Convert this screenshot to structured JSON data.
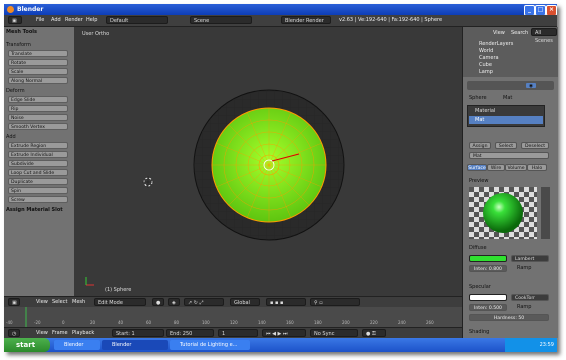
{
  "window": {
    "title": "Blender"
  },
  "topbar": {
    "file": "File",
    "add": "Add",
    "render": "Render",
    "help": "Help",
    "layout": "Default",
    "scene": "Scene",
    "engine": "Blender Render",
    "stats": "v2.63 | Ve:192-640 | Fa:192-640 | Sphere"
  },
  "tool_shelf": {
    "title": "Mesh Tools",
    "transform": {
      "header": "Transform",
      "items": [
        "Translate",
        "Rotate",
        "Scale",
        "Along Normal"
      ]
    },
    "deform": {
      "header": "Deform",
      "items": [
        "Edge Slide",
        "Rip",
        "Noise",
        "Smooth Vertex"
      ]
    },
    "add": {
      "header": "Add",
      "items": [
        "Extrude Region",
        "Extrude Individual",
        "Subdivide",
        "Loop Cut and Slide",
        "Duplicate",
        "Spin",
        "Screw"
      ]
    },
    "assign": "Assign Material Slot"
  },
  "viewport": {
    "label": "User Ortho",
    "object_label": "(1) Sphere"
  },
  "header3d": {
    "view": "View",
    "select": "Select",
    "mesh": "Mesh",
    "mode": "Edit Mode",
    "pivot": "Global"
  },
  "timeline": {
    "view": "View",
    "frame": "Frame",
    "playback": "Playback",
    "start": "Start: 1",
    "end": "End: 250",
    "current": "1",
    "sync": "No Sync",
    "ticks": [
      "-40",
      "-20",
      "0",
      "20",
      "40",
      "60",
      "80",
      "100",
      "120",
      "140",
      "160",
      "180",
      "200",
      "220",
      "240",
      "260"
    ]
  },
  "outliner": {
    "view": "View",
    "search": "Search",
    "scenes": "All Scenes",
    "items": [
      "RenderLayers",
      "World",
      "Camera",
      "Cube",
      "Lamp"
    ]
  },
  "properties": {
    "breadcrumb_obj": "Sphere",
    "breadcrumb_mat": "Mat",
    "slot_material": "Material",
    "slot_mat": "Mat",
    "assign": "Assign",
    "select": "Select",
    "deselect": "Deselect",
    "mat_name": "Mat",
    "tabs": [
      "Surface",
      "Wire",
      "Volume",
      "Halo"
    ],
    "preview": "Preview",
    "diffuse": "Diffuse",
    "diffuse_shader": "Lambert",
    "diffuse_intensity": "Inten: 0.800",
    "ramp": "Ramp",
    "specular": "Specular",
    "specular_shader": "CookTorr",
    "specular_intensity": "Inten: 0.500",
    "hardness": "Hardness: 50",
    "shading": "Shading",
    "colors": {
      "diffuse": "#2fe02f",
      "specular": "#ffffff",
      "accent": "#5680c2"
    }
  },
  "taskbar": {
    "start": "start",
    "items": [
      "Blender",
      "Blender",
      "Tutorial de Lighting e..."
    ],
    "clock": "23:59"
  }
}
